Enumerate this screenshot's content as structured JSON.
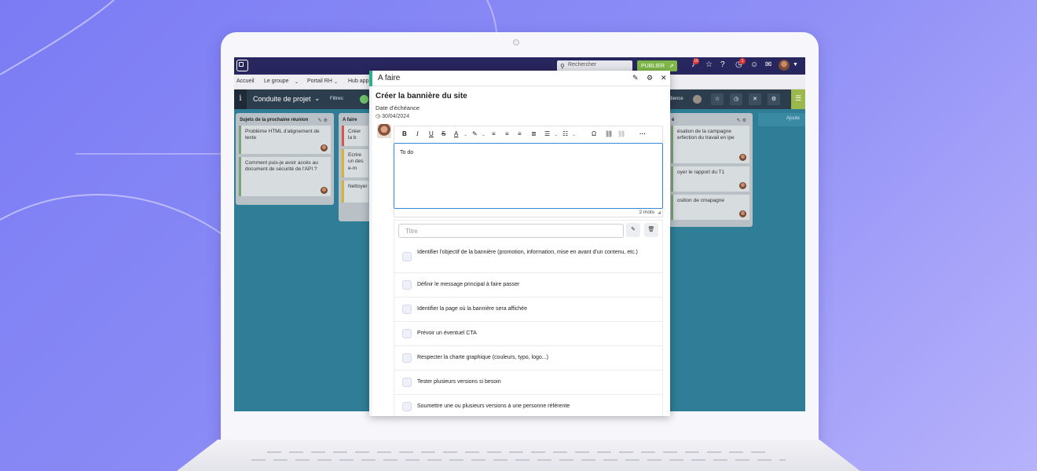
{
  "topbar": {
    "search_placeholder": "Rechercher",
    "publish_label": "PUBLIER",
    "notifications_badge": "10",
    "history_badge": "1"
  },
  "menu": {
    "items": [
      "Accueil",
      "Le groupe",
      "Portail RH",
      "Hub app"
    ]
  },
  "project": {
    "info_icon": "i",
    "title": "Conduite de projet",
    "filters_label": "Filtres:",
    "right_text": "dience"
  },
  "board": {
    "columns": [
      {
        "title": "Sujets de la prochaine réunion",
        "cards": [
          {
            "text": "Problème HTML d'alignement de texte"
          },
          {
            "text": "Comment puis-je avoir accès au document de sécurité de l'API ?"
          }
        ]
      },
      {
        "title": "A faire",
        "cards": [
          {
            "text": "Créer la b"
          },
          {
            "text": "Ecrire un des e-m"
          },
          {
            "text": "Nettoyer"
          }
        ]
      },
      {
        "title": "é",
        "cards": [
          {
            "text": "ésation de la campagne erfection du travail en ipe"
          },
          {
            "text": "oyer le rapport du T1"
          },
          {
            "text": "osition de cmapagne"
          }
        ]
      }
    ],
    "add_column": "Ajoute"
  },
  "modal": {
    "header_title": "A faire",
    "task_title": "Créer la bannière du site",
    "due_label": "Date d'échéance",
    "due_date": "30/04/2024",
    "editor_text": "To do",
    "word_count": "2 mots",
    "title_placeholder": "Titre",
    "checklist": [
      "Identifier l'objectif de la bannière (promotion, information, mise en avant d'un contenu, etc.)",
      "Définir le message principal à faire passer",
      "Identifier la page où la bannière sera affichée",
      "Prévoir un éventuel CTA",
      "Respecter la charte graphique (couleurs, typo, logo...)",
      "Tester plusieurs versions si besoin",
      "Soumettre une ou plusieurs versions à une personne référente"
    ]
  },
  "colors": {
    "background": "#7b7cf4",
    "topbar": "#28265e",
    "board": "#2f7d96",
    "accent": "#2fae8a",
    "publish": "#7fb84a",
    "editor_focus": "#3a86d8"
  }
}
